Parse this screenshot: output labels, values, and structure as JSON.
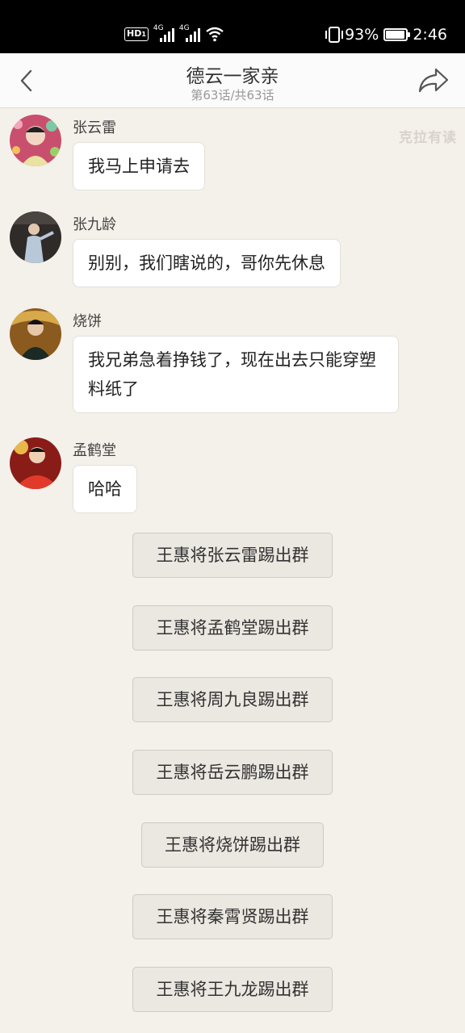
{
  "status_bar": {
    "hd": "HD",
    "hd_sub": "1",
    "net1": "4G",
    "net2": "4G",
    "battery": "93%",
    "time": "2:46"
  },
  "nav": {
    "title": "德云一家亲",
    "subtitle": "第63话/共63话"
  },
  "watermark": "克拉有读",
  "messages": [
    {
      "sender": "张云雷",
      "text": "我马上申请去",
      "avatar_color": "#d65d7a"
    },
    {
      "sender": "张九龄",
      "text": "别别，我们瞎说的，哥你先休息",
      "avatar_color": "#3a3a3a"
    },
    {
      "sender": "烧饼",
      "text": "我兄弟急着挣钱了，现在出去只能穿塑料纸了",
      "avatar_color": "#b57a2a"
    },
    {
      "sender": "孟鹤堂",
      "text": "哈哈",
      "avatar_color": "#c7261f"
    }
  ],
  "system_notices": [
    "王惠将张云雷踢出群",
    "王惠将孟鹤堂踢出群",
    "王惠将周九良踢出群",
    "王惠将岳云鹏踢出群",
    "王惠将烧饼踢出群",
    "王惠将秦霄贤踢出群",
    "王惠将王九龙踢出群"
  ]
}
